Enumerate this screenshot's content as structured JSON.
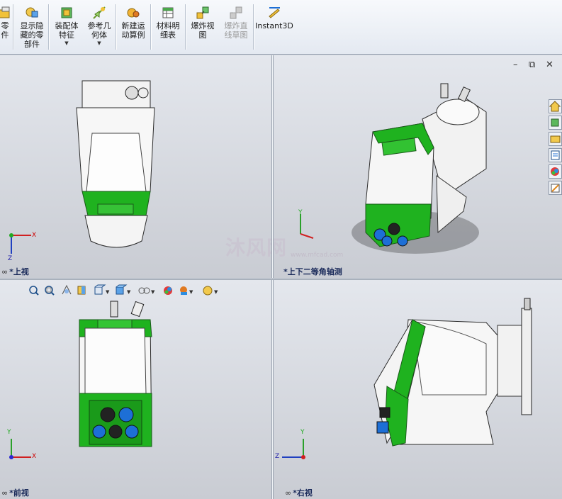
{
  "toolbar": {
    "items": [
      {
        "label_1": "零",
        "label_2": "件",
        "dropdown": false,
        "disabled": false
      },
      {
        "label_1": "显示隐",
        "label_2": "藏的零",
        "label_3": "部件",
        "dropdown": false,
        "disabled": false
      },
      {
        "label_1": "装配体",
        "label_2": "特征",
        "dropdown": true,
        "disabled": false
      },
      {
        "label_1": "参考几",
        "label_2": "何体",
        "dropdown": true,
        "disabled": false
      },
      {
        "label_1": "新建运",
        "label_2": "动算例",
        "dropdown": false,
        "disabled": false
      },
      {
        "label_1": "材料明",
        "label_2": "细表",
        "dropdown": false,
        "disabled": false
      },
      {
        "label_1": "爆炸视",
        "label_2": "图",
        "dropdown": false,
        "disabled": false
      },
      {
        "label_1": "爆炸直",
        "label_2": "线草图",
        "dropdown": false,
        "disabled": true
      },
      {
        "label_1": "Instant3D",
        "dropdown": false,
        "disabled": false
      }
    ]
  },
  "viewports": {
    "top": {
      "label": "*上视"
    },
    "iso": {
      "label": "*上下二等角轴测"
    },
    "front": {
      "label": "*前视"
    },
    "right": {
      "label": "*右视"
    }
  },
  "axes": {
    "x": "X",
    "y": "Y",
    "z": "Z"
  },
  "window_controls": {
    "minimize": "–",
    "restore": "⧉",
    "close": "✕"
  },
  "watermark": {
    "text": "沐风网",
    "url": "www.mfcad.com"
  },
  "colors": {
    "green": "#1fb21f",
    "blue": "#1d6fd6",
    "body": "#f4f4f4",
    "outline": "#2b2b2b"
  }
}
